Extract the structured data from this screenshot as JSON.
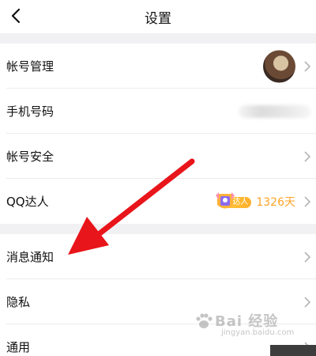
{
  "header": {
    "title": "设置"
  },
  "rows": [
    {
      "label": "帐号管理"
    },
    {
      "label": "手机号码"
    },
    {
      "label": "帐号安全"
    },
    {
      "label": "QQ达人",
      "badge_text": "达人",
      "days": "1326天"
    },
    {
      "label": "消息通知"
    },
    {
      "label": "隐私"
    },
    {
      "label": "通用"
    }
  ],
  "watermark": {
    "main": "Bai 经验",
    "sub": "jingyan.baidu.com"
  },
  "colors": {
    "accent": "#ffa328",
    "arrow": "#e8151b",
    "section_gap": "#f1f1f4"
  }
}
